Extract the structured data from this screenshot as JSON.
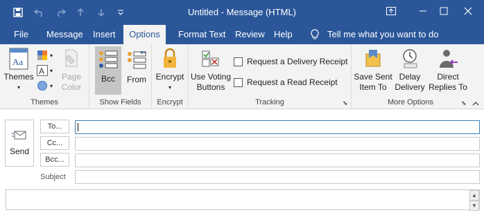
{
  "window": {
    "title": "Untitled  -  Message (HTML)"
  },
  "tabs": [
    {
      "label": "File"
    },
    {
      "label": "Message"
    },
    {
      "label": "Insert"
    },
    {
      "label": "Options"
    },
    {
      "label": "Format Text"
    },
    {
      "label": "Review"
    },
    {
      "label": "Help"
    }
  ],
  "active_tab": "Options",
  "tell_me": "Tell me what you want to do",
  "ribbon": {
    "themes": {
      "themes_label": "Themes",
      "page_color_label": "Page Color",
      "group": "Themes"
    },
    "show_fields": {
      "bcc_label": "Bcc",
      "from_label": "From",
      "group": "Show Fields"
    },
    "encrypt": {
      "encrypt_label": "Encrypt",
      "group": "Encrypt"
    },
    "tracking": {
      "voting_label": "Use Voting Buttons",
      "delivery_receipt": "Request a Delivery Receipt",
      "read_receipt": "Request a Read Receipt",
      "group": "Tracking"
    },
    "more_options": {
      "save_sent_label": "Save Sent Item To",
      "delay_label": "Delay Delivery",
      "direct_replies_label": "Direct Replies To",
      "group": "More Options"
    }
  },
  "compose": {
    "send_label": "Send",
    "to_label": "To...",
    "cc_label": "Cc...",
    "bcc_label": "Bcc...",
    "subject_label": "Subject",
    "to_value": "",
    "cc_value": "",
    "bcc_value": "",
    "subject_value": ""
  },
  "colors": {
    "brand": "#2b579a",
    "ribbon_bg": "#f3f3f3",
    "selected_bg": "#c5c5c5"
  },
  "icons": [
    "save-icon",
    "undo-icon",
    "redo-icon",
    "up-arrow-icon",
    "down-arrow-icon",
    "customize-icon",
    "restore-ribbon-icon",
    "minimize-icon",
    "maximize-icon",
    "close-icon",
    "lightbulb-icon",
    "themes-icon",
    "colors-icon",
    "fonts-icon",
    "effects-icon",
    "page-color-icon",
    "bcc-icon",
    "from-icon",
    "encrypt-icon",
    "voting-icon",
    "save-sent-icon",
    "delay-icon",
    "direct-replies-icon",
    "send-icon",
    "collapse-ribbon-icon"
  ]
}
